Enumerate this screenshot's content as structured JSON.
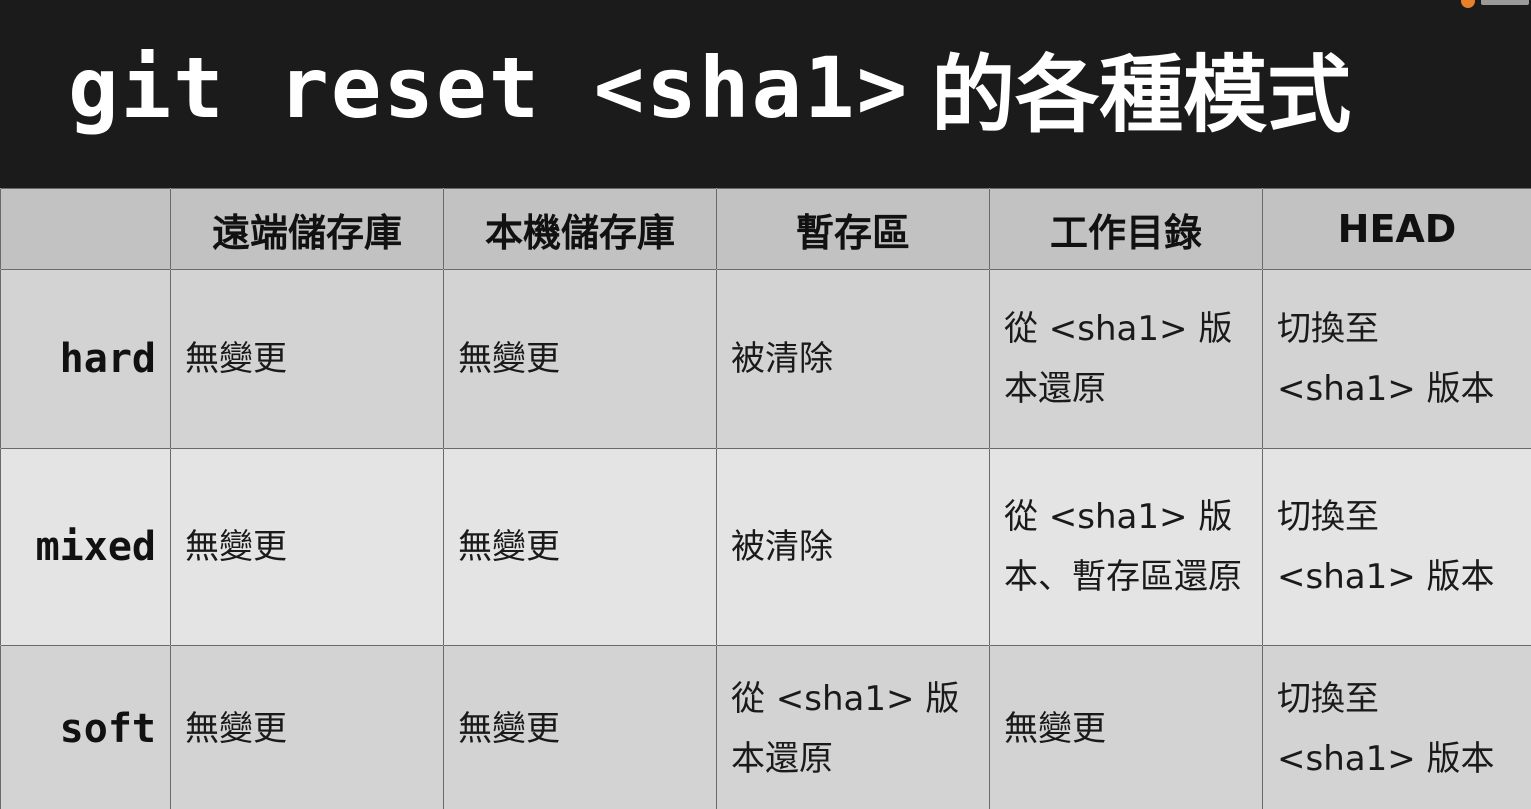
{
  "title": {
    "code": "git reset <sha1>",
    "cjk": "的各種模式"
  },
  "table": {
    "headers": [
      "",
      "遠端儲存庫",
      "本機儲存庫",
      "暫存區",
      "工作目錄",
      "HEAD"
    ],
    "rows": [
      {
        "mode": "hard",
        "cells": [
          "無變更",
          "無變更",
          "被清除",
          "從 <sha1> 版本還原",
          "切換至 <sha1> 版本"
        ]
      },
      {
        "mode": "mixed",
        "cells": [
          "無變更",
          "無變更",
          "被清除",
          "從 <sha1> 版本、暫存區還原",
          "切換至 <sha1> 版本"
        ]
      },
      {
        "mode": "soft",
        "cells": [
          "無變更",
          "無變更",
          "從 <sha1> 版本還原",
          "無變更",
          "切換至 <sha1> 版本"
        ]
      }
    ]
  },
  "colors": {
    "background": "#1b1b1b",
    "header_row": "#c2c2c2",
    "row_dark": "#d3d3d3",
    "row_light": "#e4e4e4",
    "badge_accent": "#e8802a"
  }
}
